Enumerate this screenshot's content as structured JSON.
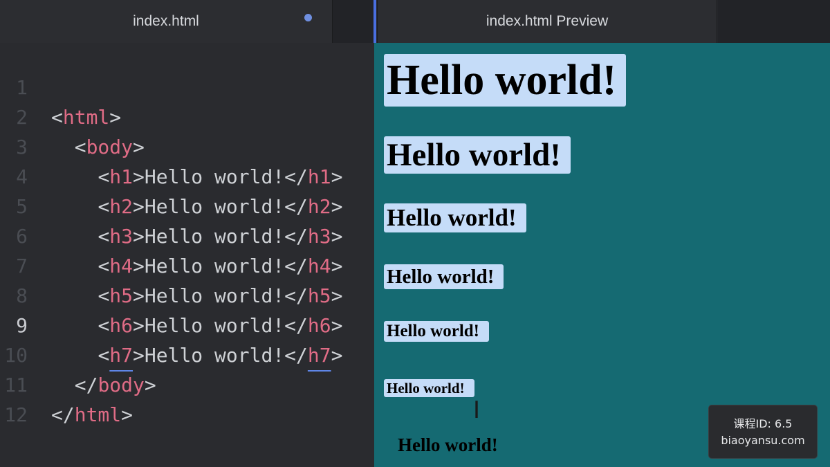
{
  "tabs": {
    "editor_title": "index.html",
    "preview_title": "index.html Preview"
  },
  "editor": {
    "current_line": 9,
    "lines": [
      {
        "num": "1",
        "indent": "",
        "open": "html",
        "text": "",
        "close": ""
      },
      {
        "num": "2",
        "indent": "  ",
        "open": "body",
        "text": "",
        "close": ""
      },
      {
        "num": "3",
        "indent": "    ",
        "open": "h1",
        "text": "Hello world!",
        "close": "h1"
      },
      {
        "num": "4",
        "indent": "    ",
        "open": "h2",
        "text": "Hello world!",
        "close": "h2"
      },
      {
        "num": "5",
        "indent": "    ",
        "open": "h3",
        "text": "Hello world!",
        "close": "h3"
      },
      {
        "num": "6",
        "indent": "    ",
        "open": "h4",
        "text": "Hello world!",
        "close": "h4"
      },
      {
        "num": "7",
        "indent": "    ",
        "open": "h5",
        "text": "Hello world!",
        "close": "h5"
      },
      {
        "num": "8",
        "indent": "    ",
        "open": "h6",
        "text": "Hello world!",
        "close": "h6"
      },
      {
        "num": "9",
        "indent": "    ",
        "open": "h7",
        "text": "Hello world!",
        "close": "h7"
      },
      {
        "num": "10",
        "indent": "  ",
        "open": "",
        "text": "",
        "close": "body"
      },
      {
        "num": "11",
        "indent": "",
        "open": "",
        "text": "",
        "close": "html"
      },
      {
        "num": "12",
        "indent": "",
        "open": "",
        "text": "",
        "close": ""
      }
    ]
  },
  "preview": {
    "headings": [
      "Hello world!",
      "Hello world!",
      "Hello world!",
      "Hello world!",
      "Hello world!",
      "Hello world!"
    ],
    "plain_text": "Hello world!"
  },
  "badge": {
    "line1": "课程ID: 6.5",
    "line2": "biaoyansu.com"
  },
  "colors": {
    "tag": "#e06c86",
    "preview_background": "#156a72",
    "highlight": "#c5dcf8",
    "accent": "#4a6fe0"
  }
}
